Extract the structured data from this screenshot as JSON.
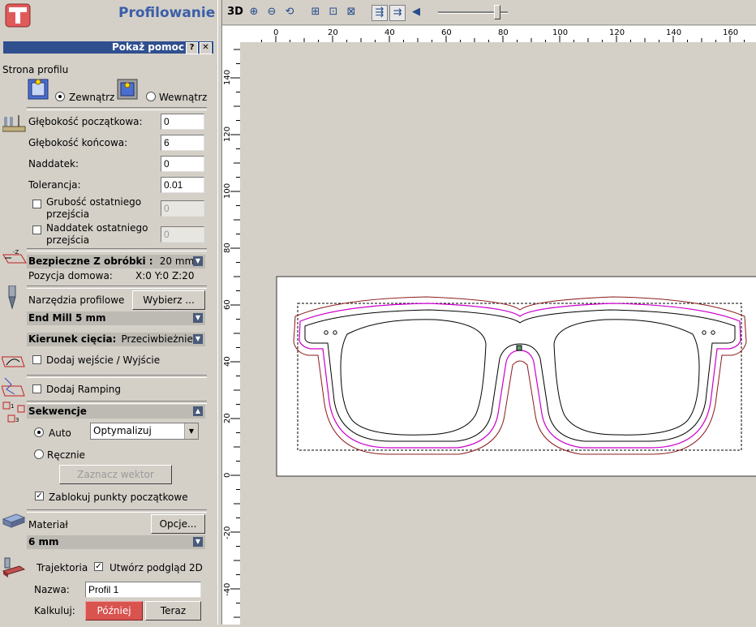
{
  "panel": {
    "title": "Profilowanie",
    "help_label": "Pokaż pomoc",
    "help_q": "?",
    "help_close": "✕",
    "side": {
      "heading": "Strona profilu",
      "outside_label": "Zewnątrz",
      "inside_label": "Wewnątrz",
      "selected": "outside"
    },
    "depth": {
      "start_label": "Głębokość początkowa:",
      "start_value": "0",
      "end_label": "Głębokość końcowa:",
      "end_value": "6",
      "allowance_label": "Naddatek:",
      "allowance_value": "0",
      "tolerance_label": "Tolerancja:",
      "tolerance_value": "0.01",
      "last_pass_thickness_label": "Grubość ostatniego przejścia",
      "last_pass_thickness_value": "0",
      "last_pass_allowance_label": "Naddatek ostatniego przejścia",
      "last_pass_allowance_value": "0"
    },
    "safe_z": {
      "label": "Bezpieczne Z obróbki :",
      "value": "20 mm",
      "home_label": "Pozycja domowa:",
      "home_value": "X:0 Y:0 Z:20"
    },
    "tools": {
      "label": "Narzędzia profilowe",
      "select_button": "Wybierz ...",
      "tool_name": "End Mill 5 mm"
    },
    "cut_direction": {
      "label": "Kierunek cięcia:",
      "value": "Przeciwbieżnie"
    },
    "leads": {
      "label": "Dodaj wejście / Wyjście",
      "checked": false
    },
    "ramping": {
      "label": "Dodaj Ramping",
      "checked": false
    },
    "sequence": {
      "label": "Sekwencje",
      "auto_label": "Auto",
      "auto_option": "Optymalizuj",
      "manual_label": "Ręcznie",
      "mark_vector_button": "Zaznacz wektor",
      "lock_start_label": "Zablokuj punkty początkowe",
      "lock_start_checked": true,
      "selected": "auto"
    },
    "material": {
      "label": "Materiał",
      "options_button": "Opcje...",
      "thickness": "6 mm"
    },
    "toolpath": {
      "label": "Trajektoria",
      "preview_label": "Utwórz podgląd 2D",
      "preview_checked": true,
      "name_label": "Nazwa:",
      "name_value": "Profil 1",
      "calc_label": "Kalkuluj:",
      "later_button": "Później",
      "now_button": "Teraz"
    }
  },
  "toolbar": {
    "mode_3d": "3D",
    "zoom_percent": 85
  },
  "rulers": {
    "x_ticks": [
      "0",
      "20",
      "40",
      "60",
      "80",
      "100",
      "120",
      "140",
      "160"
    ],
    "y_ticks": [
      "140",
      "120",
      "100",
      "80",
      "60",
      "40",
      "20",
      "0",
      "-20",
      "-40"
    ]
  },
  "colors": {
    "panel_title": "#3a5ea8",
    "help_bar": "#2f4f8f",
    "later_button": "#d9534f",
    "toolpath_magenta": "#cc00cc",
    "toolpath_brown": "#8b1a1a"
  }
}
